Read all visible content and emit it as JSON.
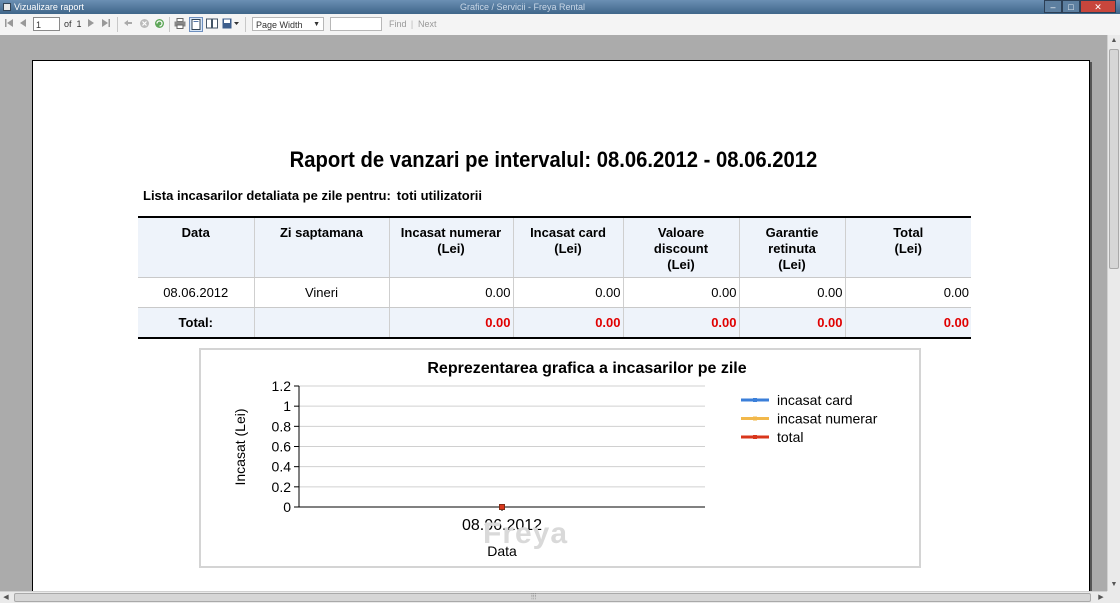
{
  "window": {
    "title": "Vizualizare raport",
    "background_title": "Grafice / Servicii - Freya Rental",
    "minimize": "–",
    "maximize": "□",
    "close": "✕"
  },
  "toolbar": {
    "first_icon": "first-page-icon",
    "prev_icon": "prev-page-icon",
    "page_number": "1",
    "of_label": "of",
    "total_pages": "1",
    "next_icon": "next-page-icon",
    "last_icon": "last-page-icon",
    "zoom_value": "Page Width",
    "find_label": "Find",
    "next_label": "Next"
  },
  "report": {
    "title": "Raport de vanzari pe intervalul: 08.06.2012 - 08.06.2012",
    "subtitle_label": "Lista incasarilor detaliata pe zile pentru:",
    "subtitle_value": "toti utilizatorii",
    "columns": [
      [
        "Data"
      ],
      [
        "Zi saptamana"
      ],
      [
        "Incasat numerar",
        "(Lei)"
      ],
      [
        "Incasat card",
        "(Lei)"
      ],
      [
        "Valoare",
        "discount",
        "(Lei)"
      ],
      [
        "Garantie",
        "retinuta",
        "(Lei)"
      ],
      [
        "Total",
        "(Lei)"
      ]
    ],
    "rows": [
      [
        "08.06.2012",
        "Vineri",
        "0.00",
        "0.00",
        "0.00",
        "0.00",
        "0.00"
      ]
    ],
    "totals": {
      "label": "Total:",
      "values": [
        "0.00",
        "0.00",
        "0.00",
        "0.00",
        "0.00"
      ]
    }
  },
  "watermark": "Freya",
  "chart_data": {
    "type": "line",
    "title": "Reprezentarea grafica a incasarilor pe zile",
    "xlabel": "Data",
    "ylabel": "Incasat (Lei)",
    "categories": [
      "08.06.2012"
    ],
    "ylim": [
      0,
      1.2
    ],
    "yticks": [
      "0",
      "0.2",
      "0.4",
      "0.6",
      "0.8",
      "1",
      "1.2"
    ],
    "grid": true,
    "legend_position": "right",
    "series": [
      {
        "name": "incasat card",
        "values": [
          0
        ],
        "color": "#3b7fd9"
      },
      {
        "name": "incasat numerar",
        "values": [
          0
        ],
        "color": "#f2b84b"
      },
      {
        "name": "total",
        "values": [
          0
        ],
        "color": "#d9361b"
      }
    ]
  }
}
